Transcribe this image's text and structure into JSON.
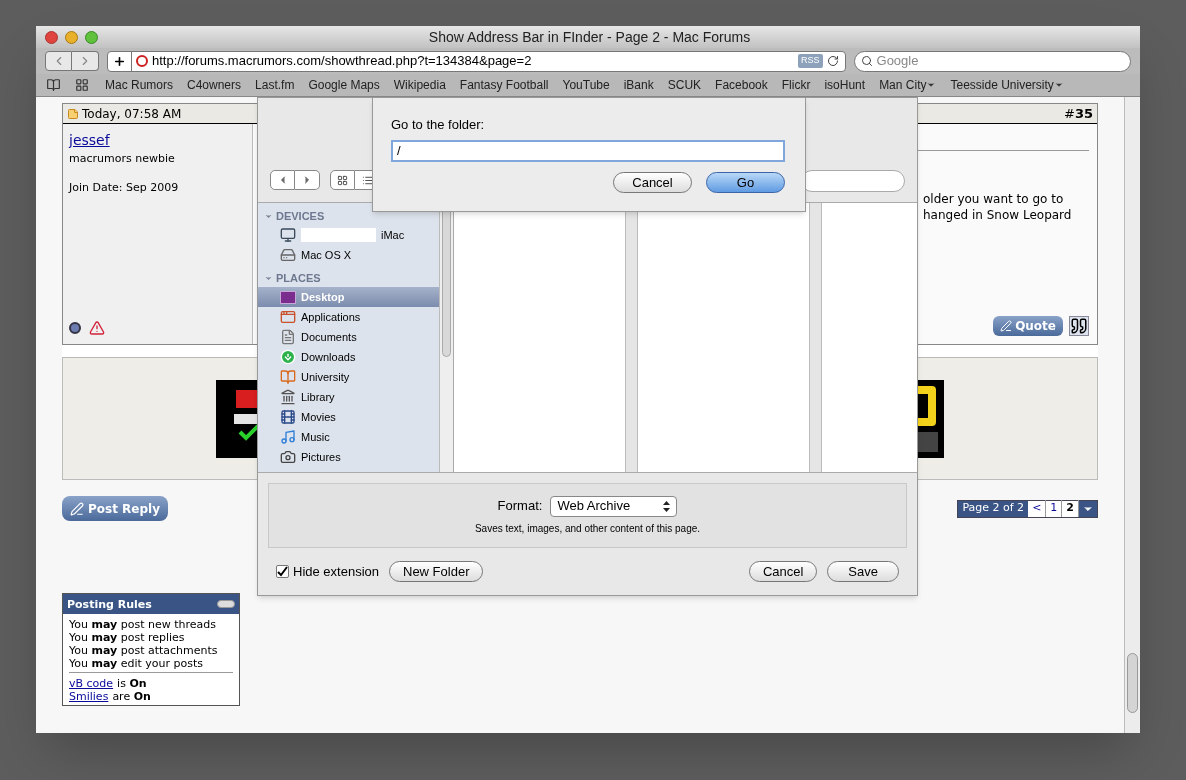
{
  "window": {
    "title": "Show Address Bar in FInder - Page 2 - Mac Forums"
  },
  "toolbar": {
    "url": "http://forums.macrumors.com/showthread.php?t=134384&page=2",
    "rss": "RSS",
    "search_placeholder": "Google"
  },
  "bookmarks": [
    {
      "label": "Mac Rumors",
      "menu": false
    },
    {
      "label": "C4owners",
      "menu": false
    },
    {
      "label": "Last.fm",
      "menu": false
    },
    {
      "label": "Google Maps",
      "menu": false
    },
    {
      "label": "Wikipedia",
      "menu": false
    },
    {
      "label": "Fantasy Football",
      "menu": false
    },
    {
      "label": "YouTube",
      "menu": false
    },
    {
      "label": "iBank",
      "menu": false
    },
    {
      "label": "SCUK",
      "menu": false
    },
    {
      "label": "Facebook",
      "menu": false
    },
    {
      "label": "Flickr",
      "menu": false
    },
    {
      "label": "isoHunt",
      "menu": false
    },
    {
      "label": "Man City",
      "menu": true
    },
    {
      "label": "Teesside University",
      "menu": true
    }
  ],
  "post": {
    "time": "Today, 07:58 AM",
    "number_sign": "#",
    "number": "35",
    "author": "jessef",
    "rank": "macrumors newbie",
    "join_date": "Join Date: Sep 2009",
    "body_lines": [
      "older you want to go to",
      "hanged in Snow Leopard"
    ],
    "quote": "Quote"
  },
  "post_reply": "Post Reply",
  "pagination": {
    "label": "Page 2 of 2",
    "prev": "<",
    "pages": [
      {
        "label": "1",
        "selected": false
      },
      {
        "label": "2",
        "selected": true
      }
    ]
  },
  "posting_rules": {
    "title": "Posting Rules",
    "rules": [
      "You **may** post new threads",
      "You **may** post replies",
      "You **may** post attachments",
      "You **may** edit your posts"
    ],
    "settings": [
      {
        "link": "vB code",
        "text": "is **On**"
      },
      {
        "link": "Smilies",
        "text": "are **On**"
      }
    ]
  },
  "save_sheet": {
    "sidebar": [
      {
        "heading": "DEVICES",
        "items": [
          {
            "label": "iMac",
            "kind": "computer",
            "selected": false
          },
          {
            "label": "Mac OS X",
            "kind": "disk",
            "selected": false
          }
        ]
      },
      {
        "heading": "PLACES",
        "items": [
          {
            "label": "Desktop",
            "kind": "desktop",
            "selected": true
          },
          {
            "label": "Applications",
            "kind": "applications",
            "selected": false
          },
          {
            "label": "Documents",
            "kind": "documents",
            "selected": false
          },
          {
            "label": "Downloads",
            "kind": "downloads",
            "selected": false
          },
          {
            "label": "University",
            "kind": "university",
            "selected": false
          },
          {
            "label": "Library",
            "kind": "library",
            "selected": false
          },
          {
            "label": "Movies",
            "kind": "movies",
            "selected": false
          },
          {
            "label": "Music",
            "kind": "music",
            "selected": false
          },
          {
            "label": "Pictures",
            "kind": "pictures",
            "selected": false
          }
        ]
      }
    ],
    "format_label": "Format:",
    "format_value": "Web Archive",
    "format_note": "Saves text, images, and other content of this page.",
    "hide_extension": {
      "label": "Hide extension",
      "checked": true
    },
    "new_folder": "New Folder",
    "cancel": "Cancel",
    "save": "Save"
  },
  "goto_sheet": {
    "label": "Go to the folder:",
    "value": "/",
    "buttons": [
      {
        "label": "Cancel",
        "default": false
      },
      {
        "label": "Go",
        "default": true
      }
    ]
  }
}
